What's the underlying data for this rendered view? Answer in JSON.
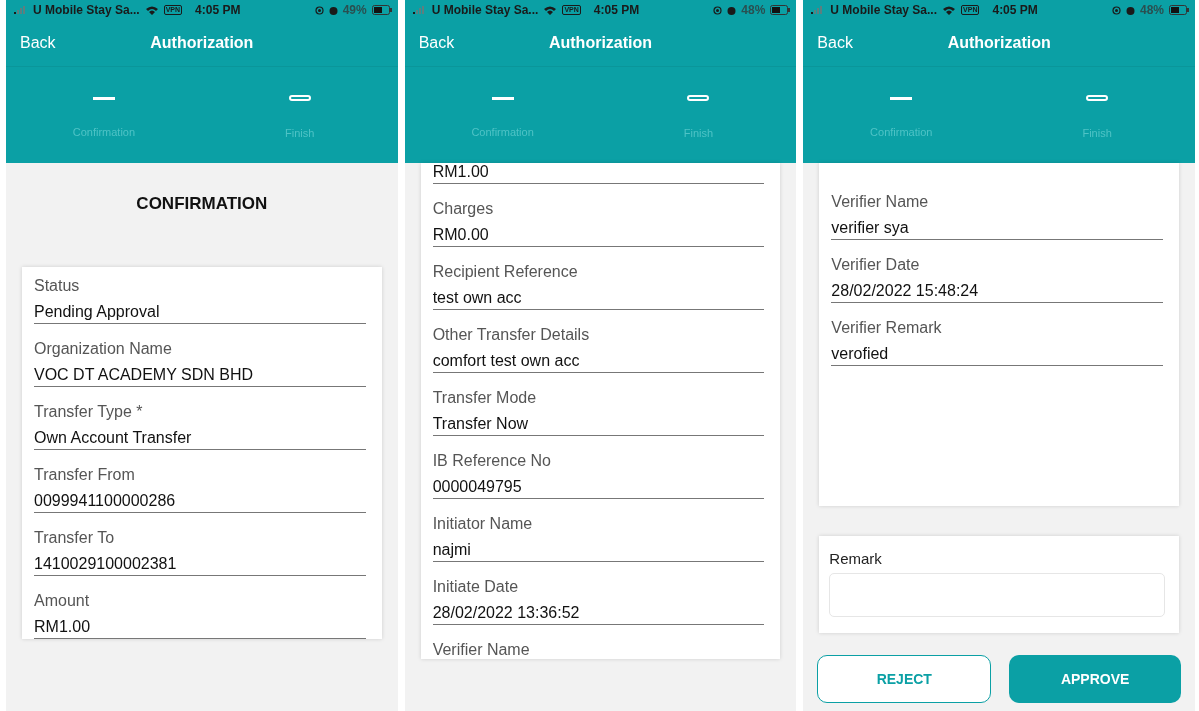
{
  "screens": [
    {
      "status_bar": {
        "carrier": "U Mobile Stay Sa...",
        "vpn": "VPN",
        "time": "4:05 PM",
        "battery": "49%"
      },
      "nav": {
        "back": "Back",
        "title": "Authorization"
      },
      "steps": [
        {
          "label": "Confirmation",
          "selected": true
        },
        {
          "label": "Finish",
          "selected": false
        }
      ],
      "heading": "CONFIRMATION",
      "fields": [
        {
          "label": "Status",
          "value": "Pending Approval"
        },
        {
          "label": "Organization Name",
          "value": "VOC DT ACADEMY SDN BHD"
        },
        {
          "label": "Transfer Type *",
          "value": "Own Account Transfer"
        },
        {
          "label": "Transfer From",
          "value": "0099941100000286"
        },
        {
          "label": "Transfer To",
          "value": "1410029100002381"
        },
        {
          "label": "Amount",
          "value": "RM1.00"
        }
      ]
    },
    {
      "status_bar": {
        "carrier": "U Mobile Stay Sa...",
        "vpn": "VPN",
        "time": "4:05 PM",
        "battery": "48%"
      },
      "nav": {
        "back": "Back",
        "title": "Authorization"
      },
      "steps": [
        {
          "label": "Confirmation",
          "selected": true
        },
        {
          "label": "Finish",
          "selected": false
        }
      ],
      "fields": [
        {
          "value": "RM1.00"
        },
        {
          "label": "Charges",
          "value": "RM0.00"
        },
        {
          "label": "Recipient Reference",
          "value": "test own acc"
        },
        {
          "label": "Other Transfer Details",
          "value": "comfort test own acc"
        },
        {
          "label": "Transfer Mode",
          "value": "Transfer Now"
        },
        {
          "label": "IB Reference No",
          "value": "0000049795"
        },
        {
          "label": "Initiator Name",
          "value": "najmi"
        },
        {
          "label": "Initiate Date",
          "value": "28/02/2022 13:36:52"
        },
        {
          "label": "Verifier Name"
        }
      ]
    },
    {
      "status_bar": {
        "carrier": "U Mobile Stay Sa...",
        "vpn": "VPN",
        "time": "4:05 PM",
        "battery": "48%"
      },
      "nav": {
        "back": "Back",
        "title": "Authorization"
      },
      "steps": [
        {
          "label": "Confirmation",
          "selected": true
        },
        {
          "label": "Finish",
          "selected": false
        }
      ],
      "fields": [
        {
          "label": "Verifier Name",
          "value": "verifier sya"
        },
        {
          "label": "Verifier Date",
          "value": "28/02/2022 15:48:24"
        },
        {
          "label": "Verifier Remark",
          "value": "verofied"
        }
      ],
      "remark": {
        "label": "Remark"
      },
      "buttons": [
        {
          "label": "REJECT",
          "kind": "outline"
        },
        {
          "label": "APPROVE",
          "kind": "filled"
        }
      ]
    }
  ]
}
